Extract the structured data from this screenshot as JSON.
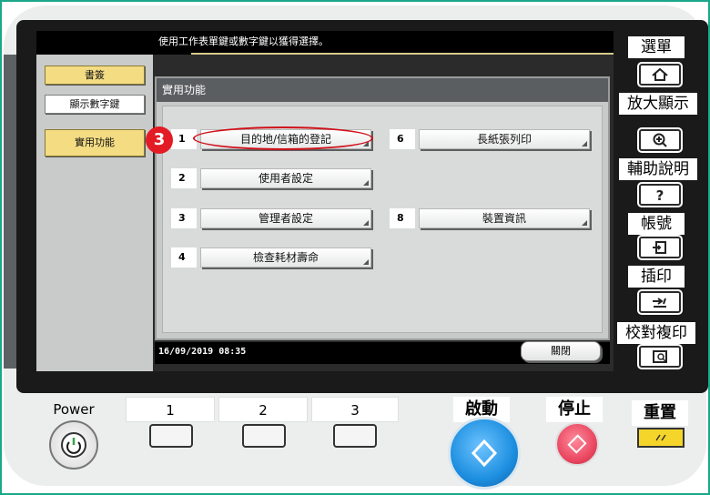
{
  "screen": {
    "instruction": "使用工作表單鍵或數字鍵以獲得選擇。",
    "left_tabs": [
      "書簽",
      "顯示數字鍵",
      "實用功能"
    ],
    "dialog_title": "實用功能",
    "functions": [
      {
        "num": "1",
        "label": "目的地/信箱的登記"
      },
      {
        "num": "2",
        "label": "使用者設定"
      },
      {
        "num": "3",
        "label": "管理者設定"
      },
      {
        "num": "4",
        "label": "檢查耗材壽命"
      },
      {
        "num": "6",
        "label": "長紙張列印"
      },
      {
        "num": "8",
        "label": "裝置資訊"
      }
    ],
    "datetime": "16/09/2019   08:35",
    "close_label": "關閉",
    "step_marker": "3"
  },
  "right_panel": {
    "items": [
      {
        "label": "選單",
        "icon": "home-icon"
      },
      {
        "label": "放大顯示",
        "icon": "zoom-in-icon"
      },
      {
        "label": "輔助說明",
        "icon": "question-icon"
      },
      {
        "label": "帳號",
        "icon": "account-icon"
      },
      {
        "label": "插印",
        "icon": "interrupt-icon"
      },
      {
        "label": "校對複印",
        "icon": "proof-copy-icon"
      }
    ]
  },
  "hardware": {
    "power_label": "Power",
    "keys": [
      "1",
      "2",
      "3"
    ],
    "start_label": "啟動",
    "stop_label": "停止",
    "reset_label": "重置"
  },
  "colors": {
    "accent_green": "#1ba88a",
    "highlight_red": "#e21b24",
    "start_blue": "#1d8fe0",
    "stop_pink": "#e8445d",
    "reset_yellow": "#f5d52a"
  }
}
